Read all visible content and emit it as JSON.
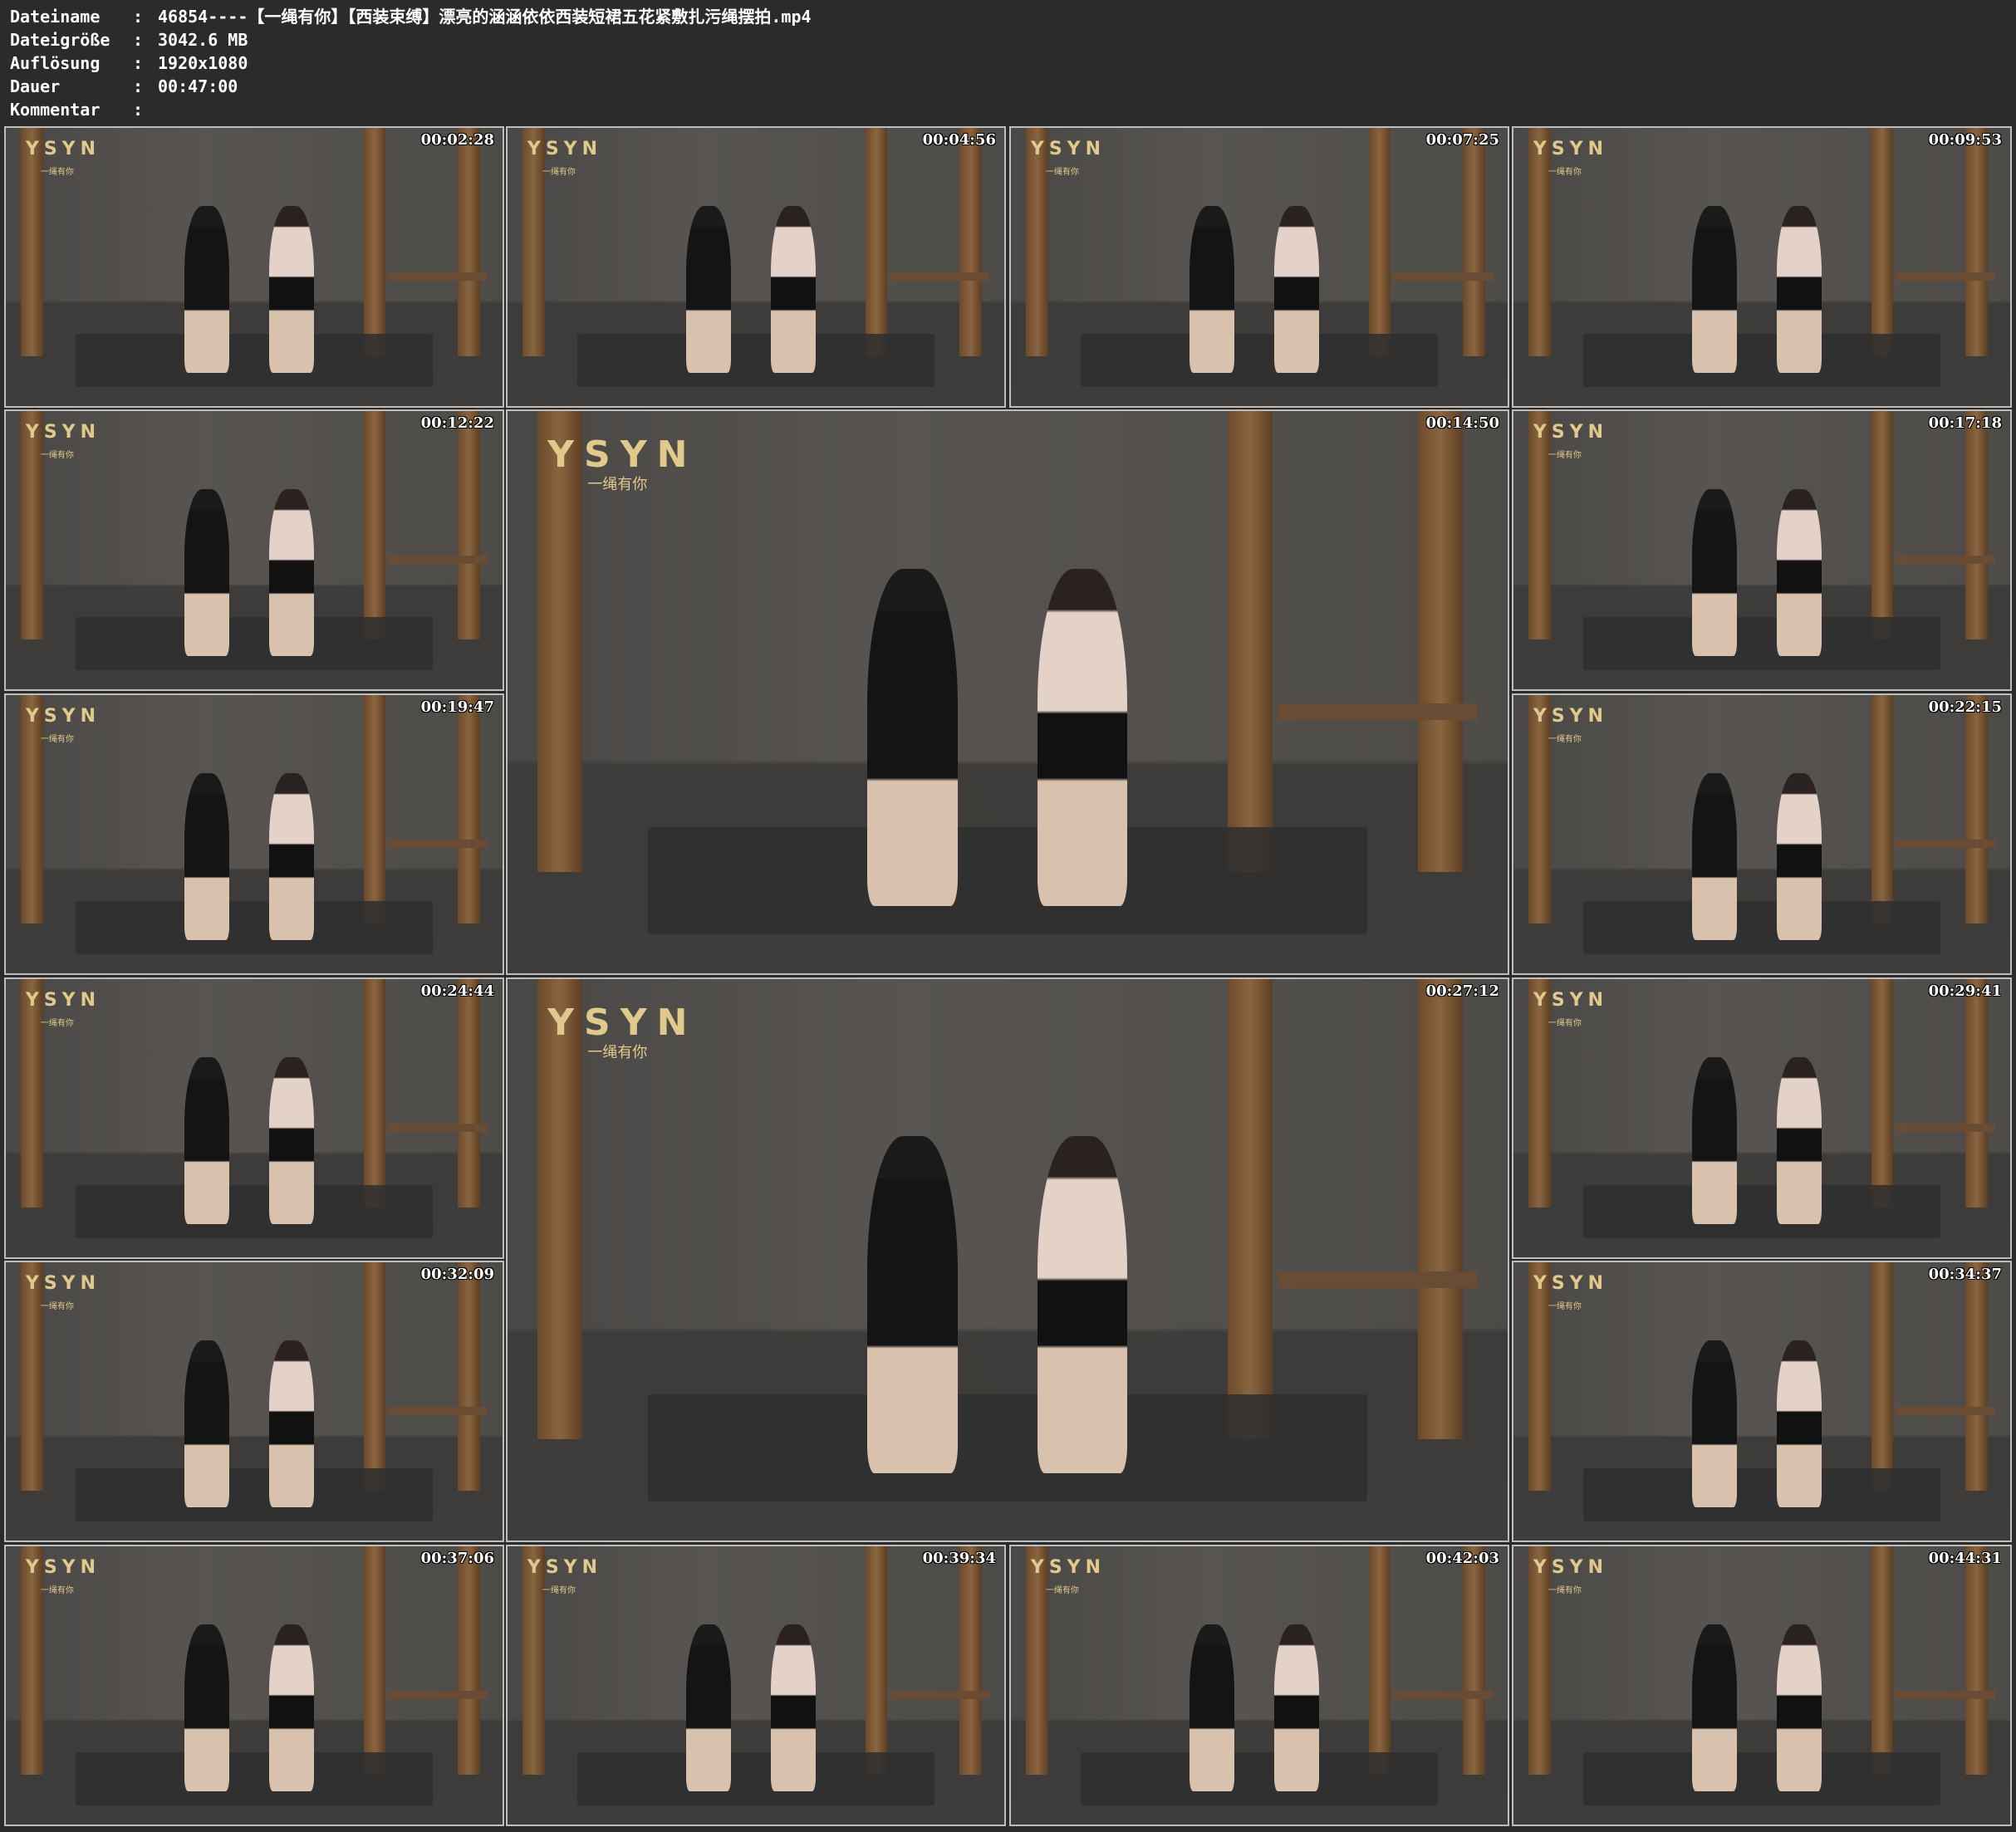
{
  "metadata": [
    {
      "label": "Dateiname",
      "value": "46854----【一绳有你】【西装束缚】漂亮的涵涵依依西装短裙五花紧敷扎污绳摆拍.mp4"
    },
    {
      "label": "Dateigröße",
      "value": "3042.6 MB"
    },
    {
      "label": "Auflösung",
      "value": "1920x1080"
    },
    {
      "label": "Dauer",
      "value": "00:47:00"
    },
    {
      "label": "Kommentar",
      "value": ""
    }
  ],
  "separator": ":",
  "logo_text": "YSYN",
  "logo_sub": "一绳有你",
  "thumbnails": [
    "00:02:28",
    "00:04:56",
    "00:07:25",
    "00:09:53",
    "00:12:22",
    "00:14:50",
    "00:17:18",
    "00:19:47",
    "00:22:15",
    "00:24:44",
    "00:27:12",
    "00:29:41",
    "00:32:09",
    "00:34:37",
    "00:37:06",
    "00:39:34",
    "00:42:03",
    "00:44:31"
  ]
}
